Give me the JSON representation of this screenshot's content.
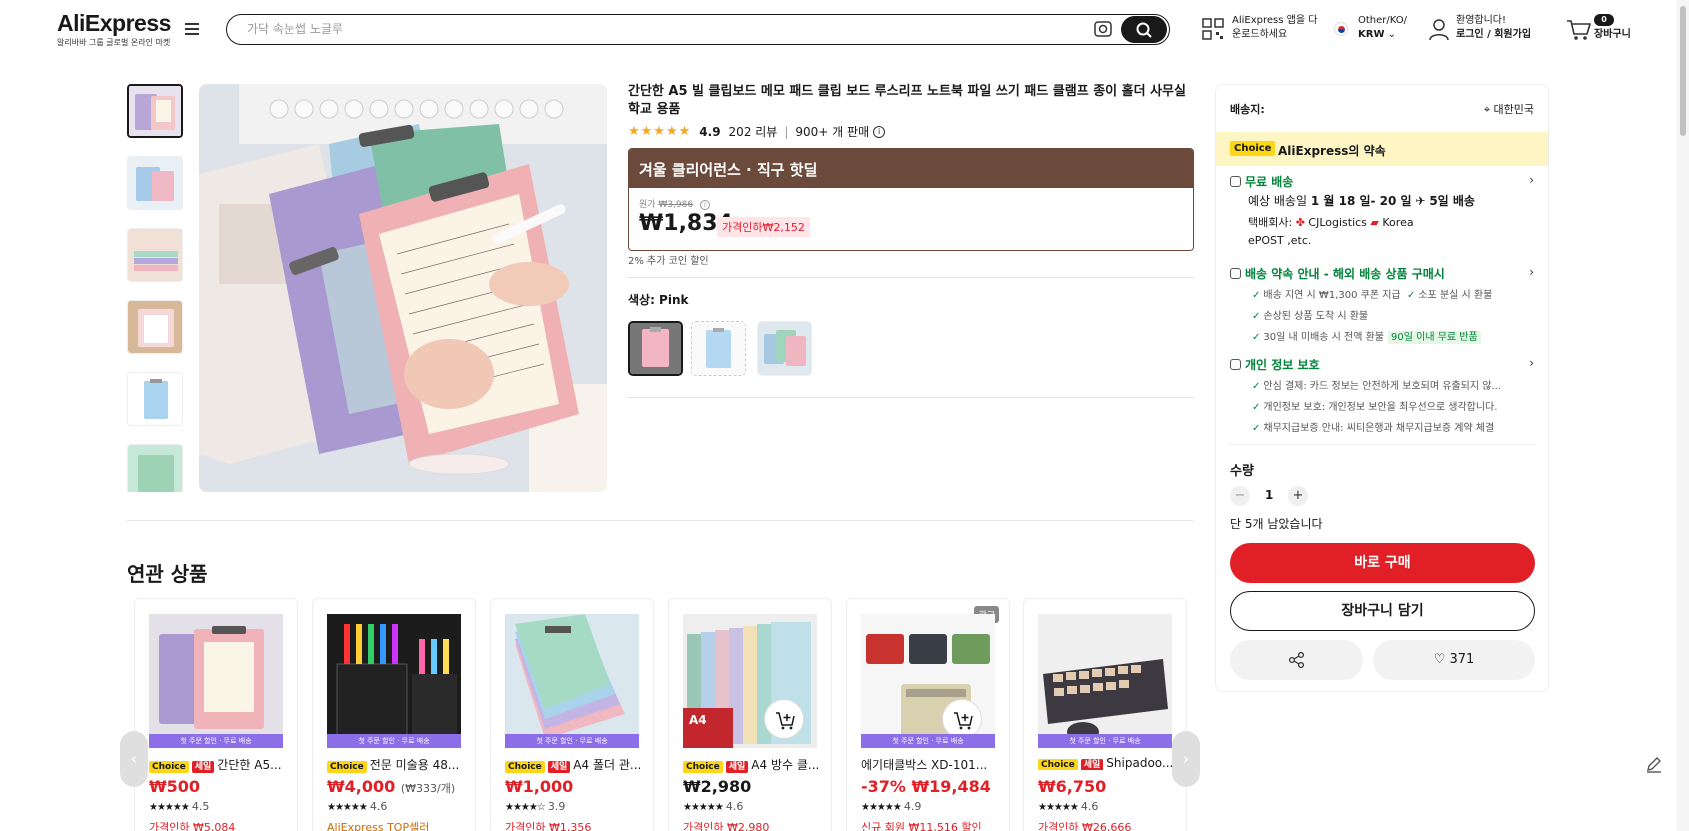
{
  "header": {
    "logo": "AliExpress",
    "logo_sub": "알리바바 그룹 글로벌 온라인 마켓",
    "search_placeholder": "가닥 속눈썹 노글루",
    "app_line1": "AliExpress 앱을 다",
    "app_line2": "운로드하세요",
    "region_line1": "Other/KO/",
    "region_line2": "KRW",
    "user_line1": "환영합니다!",
    "user_line2": "로그인 / 회원가입",
    "cart_count": "0",
    "cart_label": "장바구니"
  },
  "product": {
    "title": "간단한 A5 빌 클립보드 메모 패드 클립 보드 루스리프 노트북 파일 쓰기 패드 클램프 종이 홀더 사무실 학교 용품",
    "stars": "★★★★★",
    "rating": "4.9",
    "reviews": "202 리뷰",
    "sold": "900+ 개 판매",
    "promo_title": "겨울 클리어런스 · 직구 핫딜",
    "orig_label": "원가",
    "orig_price": "₩3,986",
    "price": "₩1,834",
    "discount": "가격인하₩2,152",
    "coin_note": "2% 추가 코인 할인",
    "color_label": "색상: Pink"
  },
  "shipping": {
    "ship_to_label": "배송지:",
    "ship_to_value": "대한민국",
    "choice_badge": "Choice",
    "choice_promise": "AliExpress의 약속",
    "free_ship": "무료 배송",
    "eta_prefix": "예상 배송일",
    "eta_dates": "1 월 18 일- 20 일",
    "eta_days": "5일 배송",
    "carrier_prefix": "택배회사:",
    "carrier1": "CJLogistics",
    "carrier2": "Korea",
    "carrier3": "ePOST ,etc.",
    "guarantee_title": "배송 약속 안내 - 해외 배송 상품 구매시",
    "g1": "배송 지연 시 ₩1,300 쿠폰 지급",
    "g2": "소포 분실 시 환불",
    "g3": "손상된 상품 도착 시 환불",
    "g4": "30일 내 미배송 시 전액 환불",
    "g4_tag": "90일 이내 무료 반품",
    "privacy_title": "개인 정보 보호",
    "p1": "안심 결제: 카드 정보는 안전하게 보호되며 유출되지 않...",
    "p2": "개인정보 보호: 개인정보 보안을 최우선으로 생각합니다.",
    "p3": "채무지급보증 안내: 씨티은행과 채무지급보증 계약 체결"
  },
  "purchase": {
    "qty_label": "수량",
    "minus": "−",
    "qty": "1",
    "plus": "+",
    "stock": "단 5개 남았습니다",
    "buy_now": "바로 구매",
    "add_cart": "장바구니 담기",
    "wish_count": "371"
  },
  "related": {
    "title": "연관 상품",
    "ribbon": "첫 주문 할인 · 무료 배송",
    "ad": "광고",
    "items": [
      {
        "choice": "Choice",
        "sale": "세일",
        "name": "간단한 A5...",
        "price": "₩500",
        "unit": "",
        "stars": "★★★★★",
        "rating": "4.5",
        "extra": "가격인하 ₩5,084"
      },
      {
        "choice": "Choice",
        "sale": "",
        "name": "전문 미술용 48...",
        "price": "₩4,000",
        "unit": "(₩333/개)",
        "stars": "★★★★★",
        "rating": "4.6",
        "extra": "AliExpress TOP셀러"
      },
      {
        "choice": "Choice",
        "sale": "세일",
        "name": "A4 폴더 관...",
        "price": "₩1,000",
        "unit": "",
        "stars": "★★★★☆",
        "rating": "3.9",
        "extra": "가격인하 ₩1,356"
      },
      {
        "choice": "Choice",
        "sale": "세일",
        "name": "A4 방수 클...",
        "price": "₩2,980",
        "unit": "",
        "stars": "★★★★★",
        "rating": "4.6",
        "extra": "가격인하 ₩2,980"
      },
      {
        "choice": "",
        "sale": "",
        "name": "에기태클박스 XD-101...",
        "price": "-37% ₩19,484",
        "unit": "",
        "stars": "★★★★★",
        "rating": "4.9",
        "extra": "신규 회원 ₩11,516 할인"
      },
      {
        "choice": "Choice",
        "sale": "세일",
        "name": "Shipadoo...",
        "price": "₩6,750",
        "unit": "",
        "stars": "★★★★★",
        "rating": "4.6",
        "extra": "가격인하 ₩26,666"
      }
    ]
  }
}
